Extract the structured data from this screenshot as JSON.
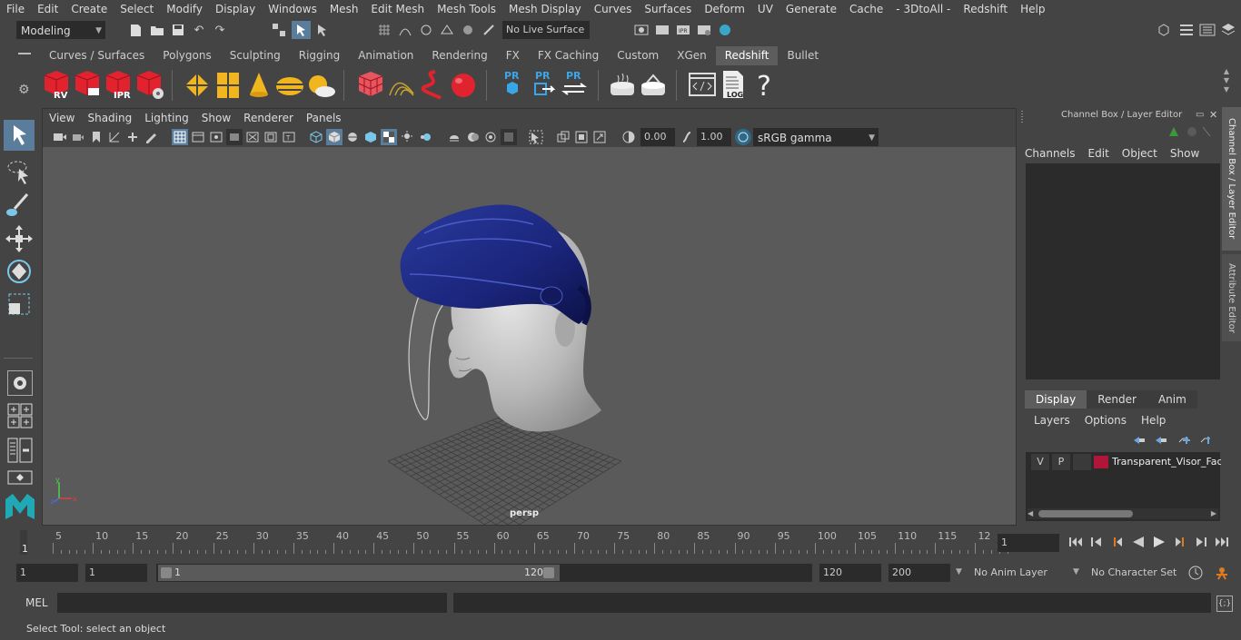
{
  "menus": [
    "File",
    "Edit",
    "Create",
    "Select",
    "Modify",
    "Display",
    "Windows",
    "Mesh",
    "Edit Mesh",
    "Mesh Tools",
    "Mesh Display",
    "Curves",
    "Surfaces",
    "Deform",
    "UV",
    "Generate",
    "Cache",
    "- 3DtoAll -",
    "Redshift",
    "Help"
  ],
  "status": {
    "mode": "Modeling",
    "live_surface": "No Live Surface"
  },
  "shelf_tabs": [
    "Curves / Surfaces",
    "Polygons",
    "Sculpting",
    "Rigging",
    "Animation",
    "Rendering",
    "FX",
    "FX Caching",
    "Custom",
    "XGen",
    "Redshift",
    "Bullet"
  ],
  "active_shelf_tab": "Redshift",
  "shelf_icons": {
    "rv": "RV",
    "ipr": "IPR",
    "pr": "PR",
    "log": "LOG",
    "help": "?"
  },
  "viewport": {
    "menus": [
      "View",
      "Shading",
      "Lighting",
      "Show",
      "Renderer",
      "Panels"
    ],
    "exposure": "0.00",
    "gamma": "1.00",
    "colorspace": "sRGB gamma",
    "camera": "persp"
  },
  "channel_box": {
    "title": "Channel Box / Layer Editor",
    "menus": [
      "Channels",
      "Edit",
      "Object",
      "Show"
    ]
  },
  "layer_editor": {
    "tabs": [
      "Display",
      "Render",
      "Anim"
    ],
    "active_tab": "Display",
    "menus": [
      "Layers",
      "Options",
      "Help"
    ],
    "layer": {
      "v": "V",
      "p": "P",
      "name": "Transparent_Visor_Fac",
      "color": "#b0163a"
    }
  },
  "side_tabs": [
    "Channel Box / Layer Editor",
    "Attribute Editor"
  ],
  "timeline": {
    "ticks": [
      "5",
      "10",
      "15",
      "20",
      "25",
      "30",
      "35",
      "40",
      "45",
      "50",
      "55",
      "60",
      "65",
      "70",
      "75",
      "80",
      "85",
      "90",
      "95",
      "100",
      "105",
      "110",
      "115",
      "12"
    ],
    "start_label": "1",
    "current_frame": "1"
  },
  "range": {
    "start": "1",
    "playback_start": "1",
    "slider_start": "1",
    "slider_end": "120",
    "playback_end": "120",
    "end": "200",
    "anim_layer": "No Anim Layer",
    "character_set": "No Character Set"
  },
  "cmdline": {
    "label": "MEL"
  },
  "help_line": "Select Tool: select an object"
}
